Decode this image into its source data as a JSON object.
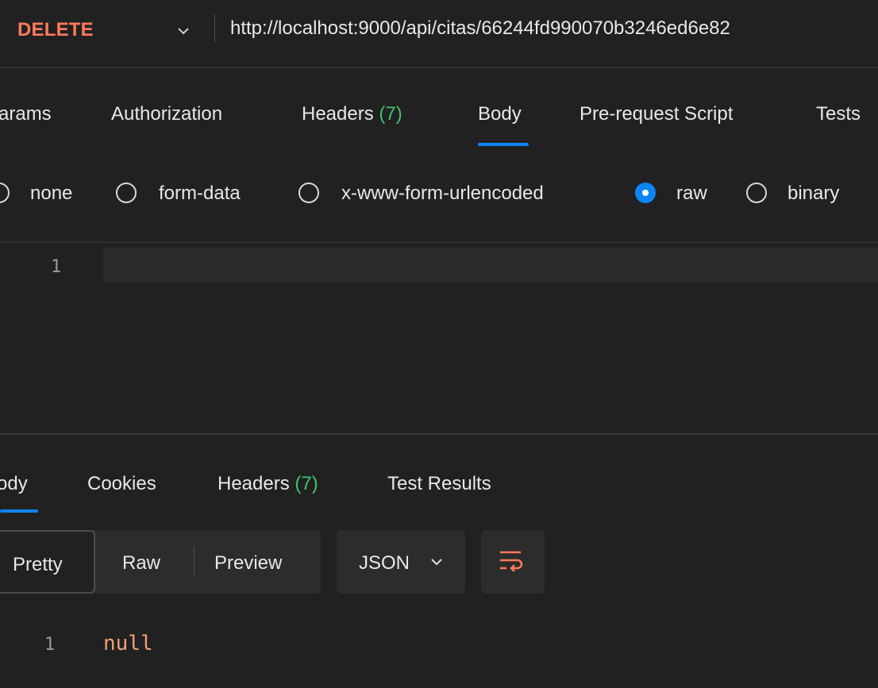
{
  "request": {
    "method": "DELETE",
    "url": "http://localhost:9000/api/citas/66244fd990070b3246ed6e82"
  },
  "request_tabs": [
    {
      "label": "arams",
      "count": ""
    },
    {
      "label": "Authorization",
      "count": ""
    },
    {
      "label": "Headers",
      "count": "(7)"
    },
    {
      "label": "Body",
      "count": "",
      "active": true
    },
    {
      "label": "Pre-request Script",
      "count": ""
    },
    {
      "label": "Tests",
      "count": ""
    }
  ],
  "body_types": [
    {
      "label": "none",
      "selected": false
    },
    {
      "label": "form-data",
      "selected": false
    },
    {
      "label": "x-www-form-urlencoded",
      "selected": false
    },
    {
      "label": "raw",
      "selected": true
    },
    {
      "label": "binary",
      "selected": false
    }
  ],
  "editor": {
    "line_number": "1",
    "content": ""
  },
  "response_tabs": [
    {
      "label": "ody",
      "count": "",
      "active": true
    },
    {
      "label": "Cookies",
      "count": ""
    },
    {
      "label": "Headers",
      "count": "(7)"
    },
    {
      "label": "Test Results",
      "count": ""
    }
  ],
  "response_view": {
    "modes": [
      "Pretty",
      "Raw",
      "Preview"
    ],
    "active_mode": "Pretty",
    "format": "JSON",
    "wrap_icon": "wrap-lines-icon"
  },
  "response_body": {
    "line_number": "1",
    "value": "null"
  },
  "colors": {
    "method": "#ff7a5c",
    "accent": "#0e84f5",
    "count": "#44c26a",
    "null_value": "#f0a078",
    "wrap_icon": "#ff7a5c"
  }
}
